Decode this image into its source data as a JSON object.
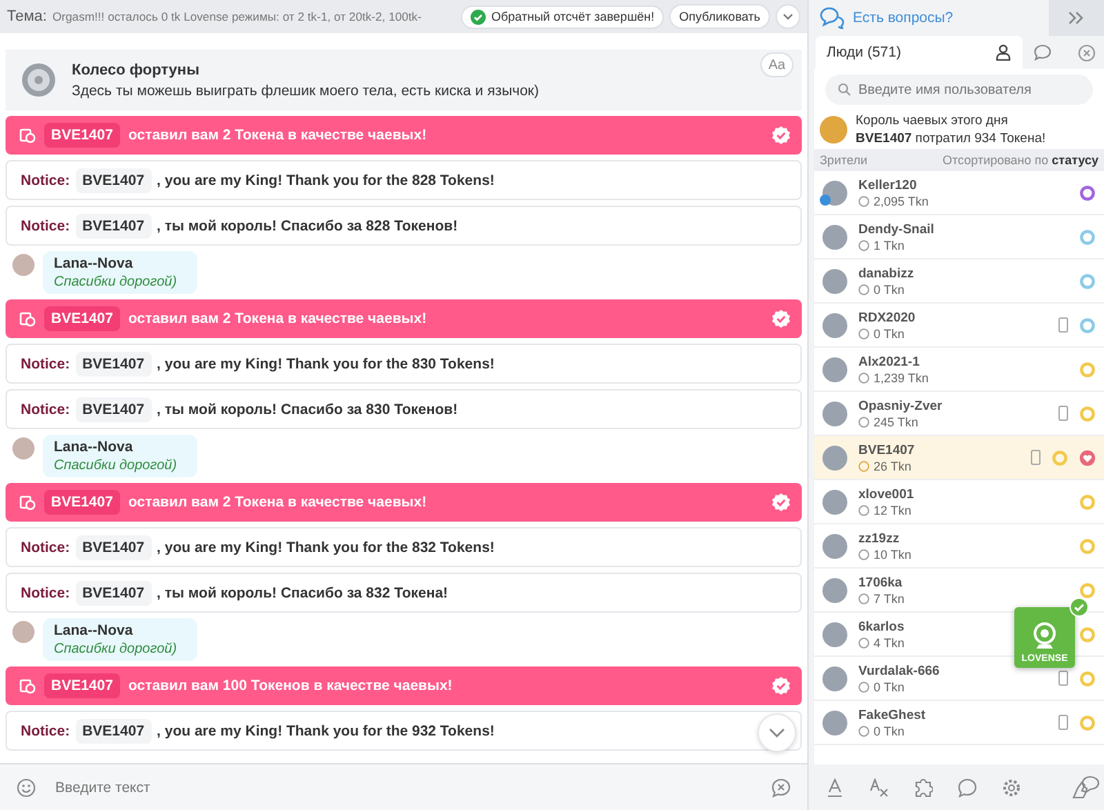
{
  "topic_bar": {
    "label": "Тема:",
    "topic": "Orgasm!!! осталось 0 tk Lovense режимы: от 2 tk-1, от 20tk-2, 100tk-",
    "status": "Обратный отсчёт завершён!",
    "publish_button": "Опубликовать"
  },
  "chat": {
    "messages": [
      {
        "kind": "wheel",
        "title": "Колесо фортуны",
        "text": "Здесь ты можешь выиграть флешик моего тела, есть киска и язычок)",
        "font_button": "Aa"
      },
      {
        "kind": "tip",
        "user": "BVE1407",
        "text": "оставил вам 2 Токена в качестве чаевых!"
      },
      {
        "kind": "notice",
        "label": "Notice:",
        "user": "BVE1407",
        "text": ", you are my King! Thank you for the 828 Tokens!"
      },
      {
        "kind": "notice",
        "label": "Notice:",
        "user": "BVE1407",
        "text": ", ты мой король! Спасибо за 828 Токенов!"
      },
      {
        "kind": "message",
        "user": "Lana--Nova",
        "text": "Спасибки дорогой)"
      },
      {
        "kind": "tip",
        "user": "BVE1407",
        "text": "оставил вам 2 Токена в качестве чаевых!"
      },
      {
        "kind": "notice",
        "label": "Notice:",
        "user": "BVE1407",
        "text": ", you are my King! Thank you for the 830 Tokens!"
      },
      {
        "kind": "notice",
        "label": "Notice:",
        "user": "BVE1407",
        "text": ", ты мой король! Спасибо за 830 Токенов!"
      },
      {
        "kind": "message",
        "user": "Lana--Nova",
        "text": "Спасибки дорогой)"
      },
      {
        "kind": "tip",
        "user": "BVE1407",
        "text": "оставил вам 2 Токена в качестве чаевых!"
      },
      {
        "kind": "notice",
        "label": "Notice:",
        "user": "BVE1407",
        "text": ", you are my King! Thank you for the 832 Tokens!"
      },
      {
        "kind": "notice",
        "label": "Notice:",
        "user": "BVE1407",
        "text": ", ты мой король! Спасибо за 832 Токена!"
      },
      {
        "kind": "message",
        "user": "Lana--Nova",
        "text": "Спасибки дорогой)"
      },
      {
        "kind": "tip",
        "user": "BVE1407",
        "text": "оставил вам 100 Токенов в качестве чаевых!"
      },
      {
        "kind": "notice",
        "label": "Notice:",
        "user": "BVE1407",
        "text": ", you are my King! Thank you for the 932 Tokens!"
      }
    ],
    "input_placeholder": "Введите текст"
  },
  "sidebar": {
    "help_link": "Есть вопросы?",
    "tabs": [
      {
        "kind": "people",
        "label": "Люди (571)",
        "selected": true
      },
      {
        "kind": "chat",
        "selected": false
      }
    ],
    "search_placeholder": "Введите имя пользователя",
    "king": {
      "title": "Король чаевых этого дня",
      "text": "**BVE1407** потратил 934 Токена!"
    },
    "list_header": {
      "label": "Зрители",
      "sort": "Отсортировано по **статусу**"
    },
    "users": [
      {
        "name": "Keller120",
        "tokens": "2,095 Tkn",
        "color": "#a066e0",
        "mobile": false,
        "heart": false,
        "highlighted": false,
        "badge": true
      },
      {
        "name": "Dendy-Snail",
        "tokens": "1 Tkn",
        "color": "#8ccbe8",
        "mobile": false,
        "heart": false,
        "highlighted": false,
        "badge": false
      },
      {
        "name": "danabizz",
        "tokens": "0 Tkn",
        "color": "#8ccbe8",
        "mobile": false,
        "heart": false,
        "highlighted": false,
        "badge": false
      },
      {
        "name": "RDX2020",
        "tokens": "0 Tkn",
        "color": "#8ccbe8",
        "mobile": true,
        "heart": false,
        "highlighted": false,
        "badge": false
      },
      {
        "name": "Alx2021-1",
        "tokens": "1,239 Tkn",
        "color": "#f2c94c",
        "mobile": false,
        "heart": false,
        "highlighted": false,
        "badge": false
      },
      {
        "name": "Opasniy-Zver",
        "tokens": "245 Tkn",
        "color": "#f2c94c",
        "mobile": true,
        "heart": false,
        "highlighted": false,
        "badge": false
      },
      {
        "name": "BVE1407",
        "tokens": "26 Tkn",
        "color": "#f2c94c",
        "mobile": true,
        "heart": true,
        "highlighted": true,
        "badge": false
      },
      {
        "name": "xlove001",
        "tokens": "12 Tkn",
        "color": "#f2c94c",
        "mobile": false,
        "heart": false,
        "highlighted": false,
        "badge": false
      },
      {
        "name": "zz19zz",
        "tokens": "10 Tkn",
        "color": "#f2c94c",
        "mobile": false,
        "heart": false,
        "highlighted": false,
        "badge": false
      },
      {
        "name": "1706ka",
        "tokens": "7 Tkn",
        "color": "#f2c94c",
        "mobile": false,
        "heart": false,
        "highlighted": false,
        "badge": false
      },
      {
        "name": "6karlos",
        "tokens": "4 Tkn",
        "color": "#f2c94c",
        "mobile": false,
        "heart": false,
        "highlighted": false,
        "badge": false
      },
      {
        "name": "Vurdalak-666",
        "tokens": "0 Tkn",
        "color": "#f2c94c",
        "mobile": true,
        "heart": false,
        "highlighted": false,
        "badge": false
      },
      {
        "name": "FakeGhest",
        "tokens": "0 Tkn",
        "color": "#f2c94c",
        "mobile": true,
        "heart": false,
        "highlighted": false,
        "badge": false
      }
    ]
  },
  "lovense_widget": {
    "label": "LOVENSE",
    "connected": true
  }
}
